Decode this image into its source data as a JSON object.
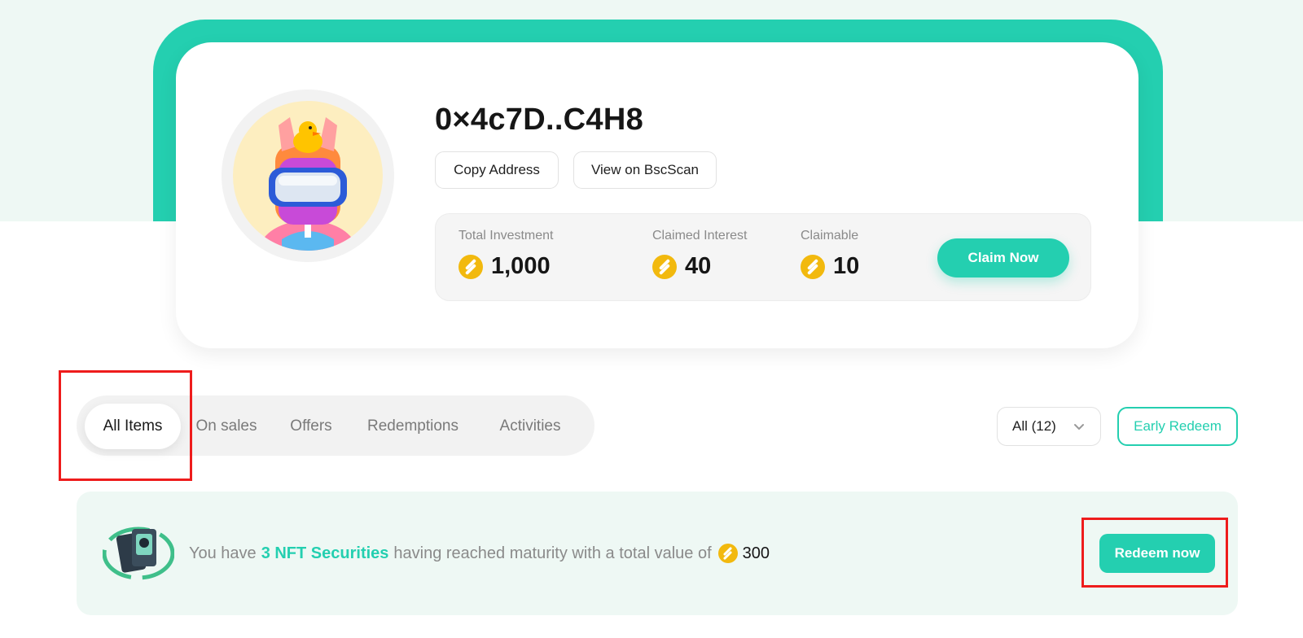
{
  "profile": {
    "address": "0×4c7D..C4H8",
    "copy_label": "Copy Address",
    "scan_label": "View on BscScan",
    "stats": [
      {
        "label": "Total Investment",
        "value": "1,000",
        "icon": "coin-icon"
      },
      {
        "label": "Claimed Interest",
        "value": "40",
        "icon": "coin-icon"
      },
      {
        "label": "Claimable",
        "value": "10",
        "icon": "coin-icon"
      }
    ],
    "claim_label": "Claim Now"
  },
  "tabs": [
    {
      "label": "All Items",
      "active": true
    },
    {
      "label": "On sales",
      "active": false
    },
    {
      "label": "Offers",
      "active": false
    },
    {
      "label": "Redemptions",
      "active": false
    },
    {
      "label": "Activities",
      "active": false
    }
  ],
  "filter": {
    "selected": "All (12)",
    "early_redeem_label": "Early Redeem"
  },
  "banner": {
    "text_before": "You have",
    "highlight": "3 NFT Securities",
    "text_after": "having reached maturity with a total value of",
    "value": "300",
    "redeem_label": "Redeem now"
  },
  "colors": {
    "accent": "#24cfb0",
    "coin": "#f2b90e",
    "highlight_box": "#ee1c1c",
    "background_tint": "#eef8f4"
  }
}
